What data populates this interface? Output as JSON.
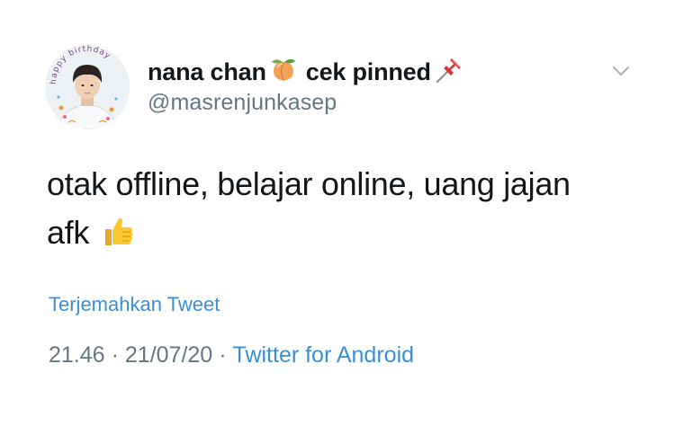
{
  "tweet": {
    "display_name": "nana chan",
    "display_name_suffix": "cek pinned",
    "handle": "@masrenjunkasep",
    "text_line1": "otak offline, belajar online, uang jajan",
    "text_line2": "afk",
    "translate_label": "Terjemahkan Tweet",
    "time": "21.46",
    "date": "21/07/20",
    "separator": "·",
    "source": "Twitter for Android"
  },
  "avatar": {
    "overlay_text": "happy birthday"
  },
  "icons": {
    "name_emoji_1": "peach-emoji-icon",
    "name_emoji_2": "pushpin-emoji-icon",
    "text_emoji": "thumbs-up-emoji-icon",
    "menu": "chevron-down-icon"
  },
  "colors": {
    "text": "#14171a",
    "secondary": "#657786",
    "link": "#3b8fd6",
    "background": "#ffffff"
  }
}
